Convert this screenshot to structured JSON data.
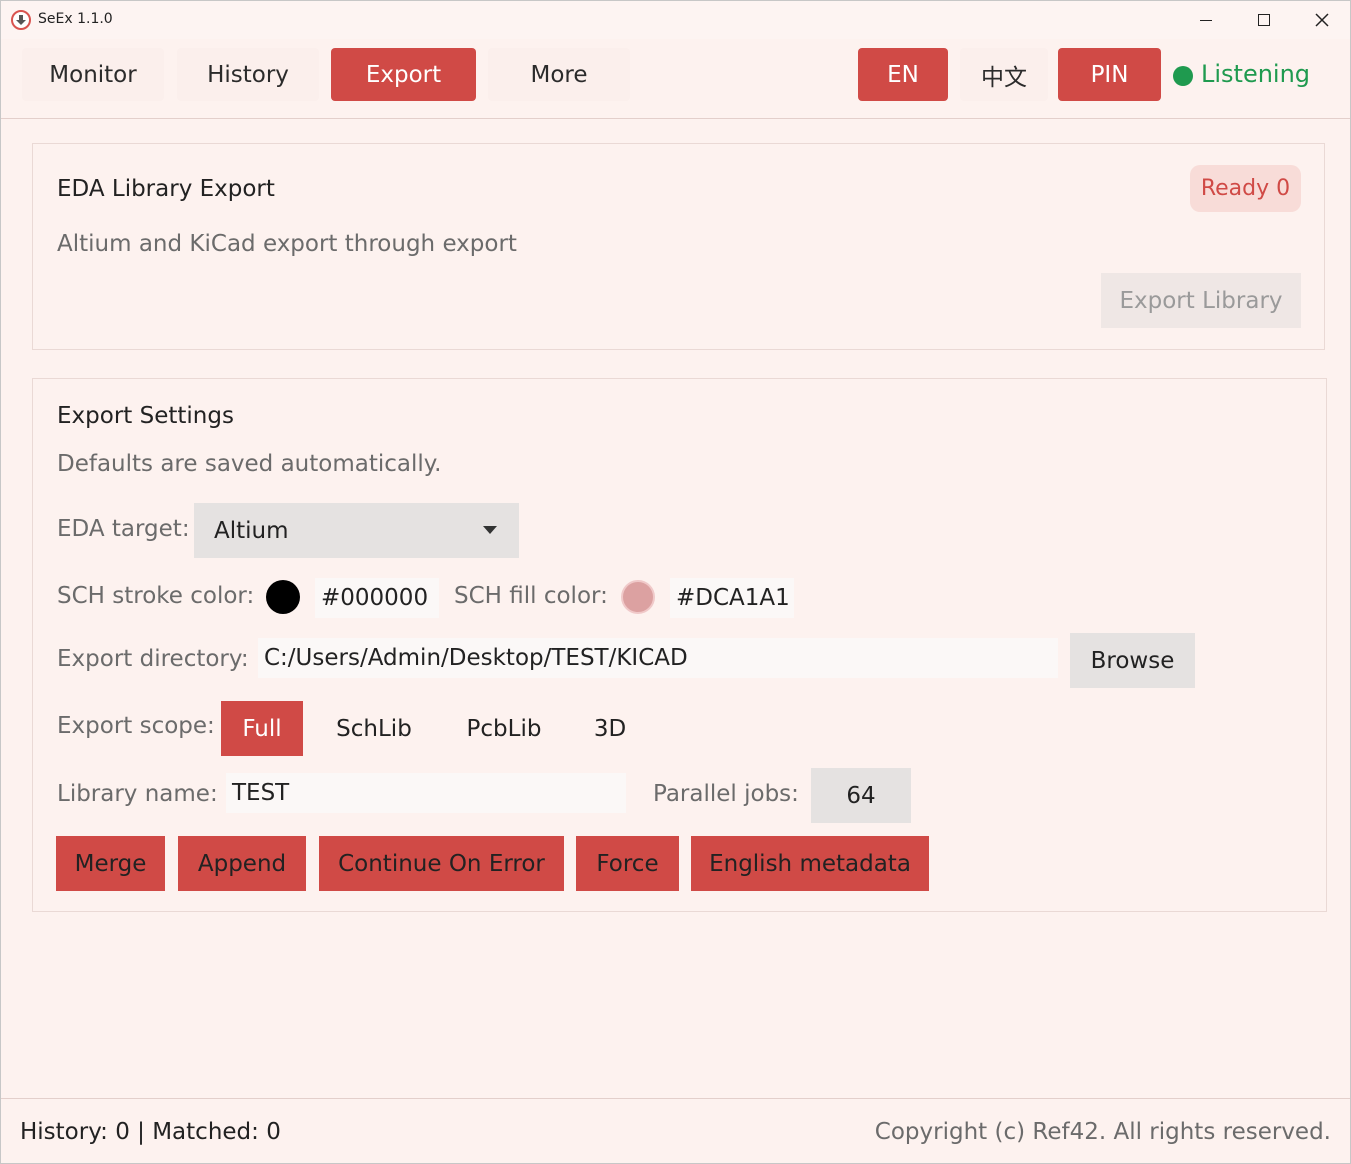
{
  "window": {
    "title": "SeEx 1.1.0"
  },
  "nav": {
    "tabs": [
      "Monitor",
      "History",
      "Export",
      "More"
    ],
    "active_tab": "Export",
    "lang_en": "EN",
    "lang_zh": "中文",
    "pin": "PIN",
    "status": "Listening"
  },
  "eda_export": {
    "title": "EDA Library Export",
    "subtitle": "Altium and KiCad export through export",
    "badge": "Ready 0",
    "export_button": "Export Library"
  },
  "settings": {
    "title": "Export Settings",
    "subtitle": "Defaults are saved automatically.",
    "eda_target_label": "EDA target:",
    "eda_target_value": "Altium",
    "stroke_label": "SCH stroke color:",
    "stroke_value": "#000000",
    "fill_label": "SCH fill color:",
    "fill_value": "#DCA1A1",
    "dir_label": "Export directory:",
    "dir_value": "C:/Users/Admin/Desktop/TEST/KICAD",
    "browse_button": "Browse",
    "scope_label": "Export scope:",
    "scope_options": [
      "Full",
      "SchLib",
      "PcbLib",
      "3D"
    ],
    "scope_selected": "Full",
    "libname_label": "Library name:",
    "libname_value": "TEST",
    "jobs_label": "Parallel jobs:",
    "jobs_value": "64",
    "options": [
      "Merge",
      "Append",
      "Continue On Error",
      "Force",
      "English metadata"
    ]
  },
  "footer": {
    "stats": "History: 0 | Matched: 0",
    "copyright": "Copyright (c) Ref42. All rights reserved."
  },
  "colors": {
    "accent": "#d04a46",
    "background": "#fdf2ef",
    "status_green": "#1f9a4f",
    "stroke_swatch": "#000000",
    "fill_swatch": "#DCA1A1"
  }
}
